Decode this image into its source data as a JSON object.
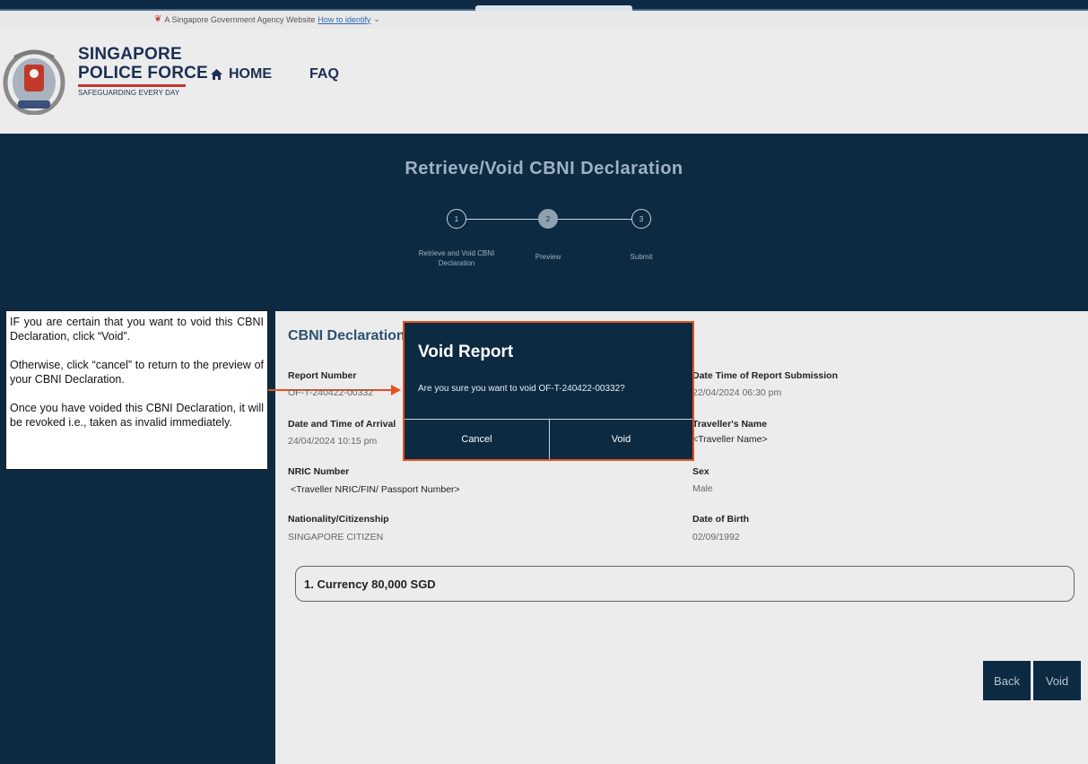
{
  "gov_bar": {
    "text": "A Singapore Government Agency Website",
    "link": "How to identify"
  },
  "brand": {
    "line1": "SINGAPORE",
    "line2": "POLICE FORCE",
    "tagline": "SAFEGUARDING EVERY DAY"
  },
  "nav": {
    "home": "HOME",
    "faq": "FAQ"
  },
  "page": {
    "title": "Retrieve/Void CBNI Declaration"
  },
  "steps": [
    {
      "number": "1",
      "label": "Retrieve and Void CBNI Declaration"
    },
    {
      "number": "2",
      "label": "Preview"
    },
    {
      "number": "3",
      "label": "Submit"
    }
  ],
  "annotation": {
    "p1": "IF you are certain that you want to void this CBNI Declaration, click “Void”.",
    "p2": "Otherwise, click “cancel” to return to the preview of your CBNI Declaration.",
    "p3": "Once you have voided this CBNI Declaration, it will be revoked i.e., taken as invalid immediately."
  },
  "section": {
    "title": "CBNI Declaration S"
  },
  "fields": {
    "report_number": {
      "label": "Report Number",
      "value": "OF-T-240422-00332"
    },
    "date_time_submission": {
      "label": "Date Time of Report Submission",
      "value": "22/04/2024 06:30 pm"
    },
    "date_time_arrival": {
      "label": "Date and Time of Arrival",
      "value": "24/04/2024 10:15 pm"
    },
    "traveller_name": {
      "label": "Traveller's Name",
      "value": "<Traveller Name>"
    },
    "nric": {
      "label": "NRIC Number",
      "value": "<Traveller NRIC/FIN/ Passport Number>"
    },
    "sex": {
      "label": "Sex",
      "value": "Male"
    },
    "nationality": {
      "label": "Nationality/Citizenship",
      "value": "SINGAPORE CITIZEN"
    },
    "dob": {
      "label": "Date of Birth",
      "value": "02/09/1992"
    }
  },
  "currency_item": "1. Currency 80,000 SGD",
  "buttons": {
    "back": "Back",
    "void": "Void"
  },
  "modal": {
    "title": "Void Report",
    "message": "Are you sure you want to void OF-T-240422-00332?",
    "cancel": "Cancel",
    "void": "Void"
  },
  "colors": {
    "navy": "#0c2a42",
    "accent_orange": "#e2531f",
    "brand_red": "#c0392b"
  }
}
